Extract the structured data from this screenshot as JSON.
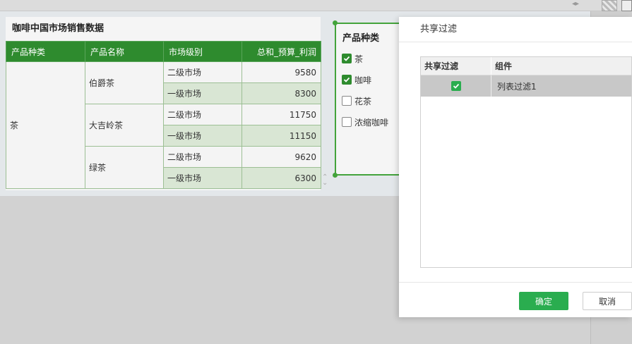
{
  "table_widget": {
    "title": "咖啡中国市场销售数据",
    "headers": [
      "产品种类",
      "产品名称",
      "市场级别",
      "总和_预算_利润"
    ],
    "category": "茶",
    "products": [
      "伯爵茶",
      "大吉岭茶",
      "绿茶"
    ],
    "rows": [
      {
        "level": "二级市场",
        "value": "9580"
      },
      {
        "level": "一级市场",
        "value": "8300"
      },
      {
        "level": "二级市场",
        "value": "11750"
      },
      {
        "level": "一级市场",
        "value": "11150"
      },
      {
        "level": "二级市场",
        "value": "9620"
      },
      {
        "level": "一级市场",
        "value": "6300"
      }
    ]
  },
  "filter_widget": {
    "title": "产品种类",
    "items": [
      {
        "label": "茶",
        "checked": true
      },
      {
        "label": "咖啡",
        "checked": true
      },
      {
        "label": "花茶",
        "checked": false
      },
      {
        "label": "浓缩咖啡",
        "checked": false
      }
    ]
  },
  "modal": {
    "title": "共享过滤",
    "columns": [
      "共享过滤",
      "组件"
    ],
    "rows": [
      {
        "checked": true,
        "component": "列表过滤1"
      }
    ],
    "ok_label": "确定",
    "cancel_label": "取消"
  },
  "colors": {
    "header_green": "#2e8b2e",
    "accent_green": "#2aad4f",
    "filter_border": "#43a33b"
  }
}
